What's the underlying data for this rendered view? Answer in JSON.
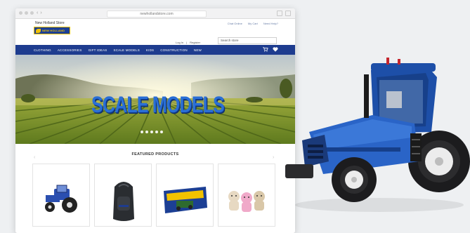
{
  "browser": {
    "url": "newhollandstore.com",
    "nav_back": "‹",
    "nav_forward": "›"
  },
  "header": {
    "site_name": "New Holland Store",
    "logo_text": "NEW HOLLAND",
    "top_links": [
      "Chat Online",
      "My Cart",
      "Need Help?"
    ],
    "account_links": [
      "Log In",
      "|",
      "Register"
    ],
    "search_placeholder": "Search store"
  },
  "nav": {
    "items": [
      "CLOTHING",
      "ACCESSORIES",
      "GIFT IDEAS",
      "SCALE MODELS",
      "KIDS",
      "CONSTRUCTION",
      "NEW"
    ]
  },
  "hero": {
    "headline": "SCALE MODELS"
  },
  "featured": {
    "title": "FEATURED PRODUCTS",
    "prev": "‹",
    "next": "›",
    "products": [
      {
        "icon": "tractor-toy"
      },
      {
        "icon": "backpack"
      },
      {
        "icon": "boxed-model"
      },
      {
        "icon": "plush-toys"
      }
    ]
  },
  "colors": {
    "brand_blue": "#1e3c8f",
    "logo_yellow": "#f2c200",
    "tractor_blue": "#1d4fa8"
  }
}
